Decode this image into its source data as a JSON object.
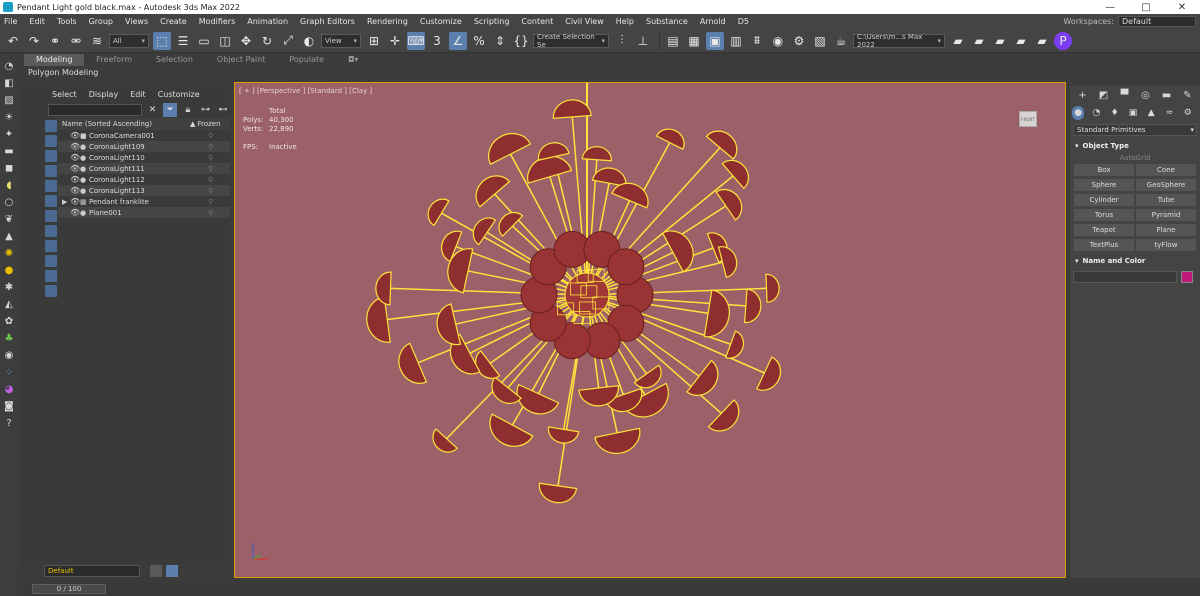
{
  "window": {
    "title": "Pendant Light gold black.max - Autodesk 3ds Max 2022",
    "minimize": "—",
    "maximize": "□",
    "close": "✕"
  },
  "menu": [
    "File",
    "Edit",
    "Tools",
    "Group",
    "Views",
    "Create",
    "Modifiers",
    "Animation",
    "Graph Editors",
    "Rendering",
    "Customize",
    "Scripting",
    "Content",
    "Civil View",
    "Help",
    "Substance",
    "Arnold",
    "D5"
  ],
  "workspace": {
    "label": "Workspaces:",
    "value": "Default"
  },
  "toolbar": {
    "selection_filter": "All",
    "ref_coord": "View",
    "named_selection": "Create Selection Se",
    "project_path": "C:\\Users\\m...s Max 2022"
  },
  "ribbon": {
    "tabs": [
      "Modeling",
      "Freeform",
      "Selection",
      "Object Paint",
      "Populate"
    ],
    "sub_label": "Polygon Modeling"
  },
  "scene_explorer": {
    "menu": [
      "Select",
      "Display",
      "Edit",
      "Customize"
    ],
    "header_name": "Name (Sorted Ascending)",
    "header_frozen": "▲ Frozen",
    "rows": [
      {
        "name": "CoronaCamera001",
        "type": "cam"
      },
      {
        "name": "CoronaLight109",
        "type": "light"
      },
      {
        "name": "CoronaLight110",
        "type": "light"
      },
      {
        "name": "CoronaLight111",
        "type": "light"
      },
      {
        "name": "CoronaLight112",
        "type": "light"
      },
      {
        "name": "CoronaLight113",
        "type": "light"
      },
      {
        "name": "Pendant franklite",
        "type": "group"
      },
      {
        "name": "Plane001",
        "type": "geo"
      }
    ],
    "layer": "Default"
  },
  "viewport": {
    "label": "[ + ] [Perspective ] [Standard ] [Clay ]",
    "stats_total": "Total",
    "polys_label": "Polys:",
    "polys_value": "40,300",
    "verts_label": "Verts:",
    "verts_value": "22,890",
    "fps_label": "FPS:",
    "fps_value": "Inactive",
    "viewcube_label": "FRONT",
    "bg_color": "#9b6068",
    "selection_color": "#ffe23a"
  },
  "timeline": {
    "value": "0 / 100"
  },
  "command_panel": {
    "category": "Standard Primitives",
    "object_type_title": "Object Type",
    "autogrid": "AutoGrid",
    "buttons": [
      "Box",
      "Cone",
      "Sphere",
      "GeoSphere",
      "Cylinder",
      "Tube",
      "Torus",
      "Pyramid",
      "Teapot",
      "Plane",
      "TextPlus",
      "tyFlow"
    ],
    "name_color_title": "Name and Color",
    "swatch_color": "#c2187a"
  }
}
